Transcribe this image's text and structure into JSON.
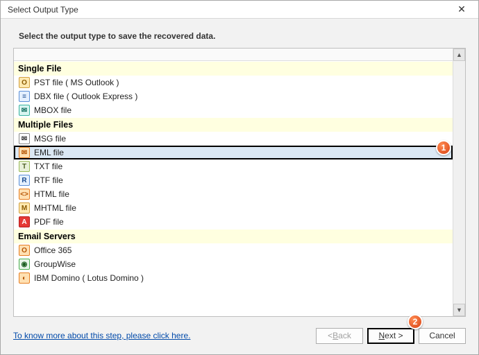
{
  "window": {
    "title": "Select Output Type"
  },
  "instruction": "Select the output type to save the recovered data.",
  "groups": {
    "single": {
      "header": "Single File",
      "items": {
        "pst": "PST file ( MS Outlook )",
        "dbx": "DBX file ( Outlook Express )",
        "mbox": "MBOX file"
      }
    },
    "multi": {
      "header": "Multiple Files",
      "items": {
        "msg": "MSG file",
        "eml": "EML file",
        "txt": "TXT file",
        "rtf": "RTF file",
        "html": "HTML file",
        "mhtml": "MHTML file",
        "pdf": "PDF file"
      }
    },
    "servers": {
      "header": "Email Servers",
      "items": {
        "o365": "Office 365",
        "gw": "GroupWise",
        "ibm": "IBM Domino ( Lotus Domino )"
      }
    }
  },
  "selected": "eml",
  "footer": {
    "help": "To know more about this step, please click here.",
    "back_prefix": "< ",
    "back_u": "B",
    "back_suffix": "ack",
    "next_u": "N",
    "next_suffix": "ext >",
    "cancel": "Cancel"
  },
  "callouts": {
    "one": "1",
    "two": "2"
  },
  "scrollbar": {
    "up": "▲",
    "down": "▼"
  }
}
